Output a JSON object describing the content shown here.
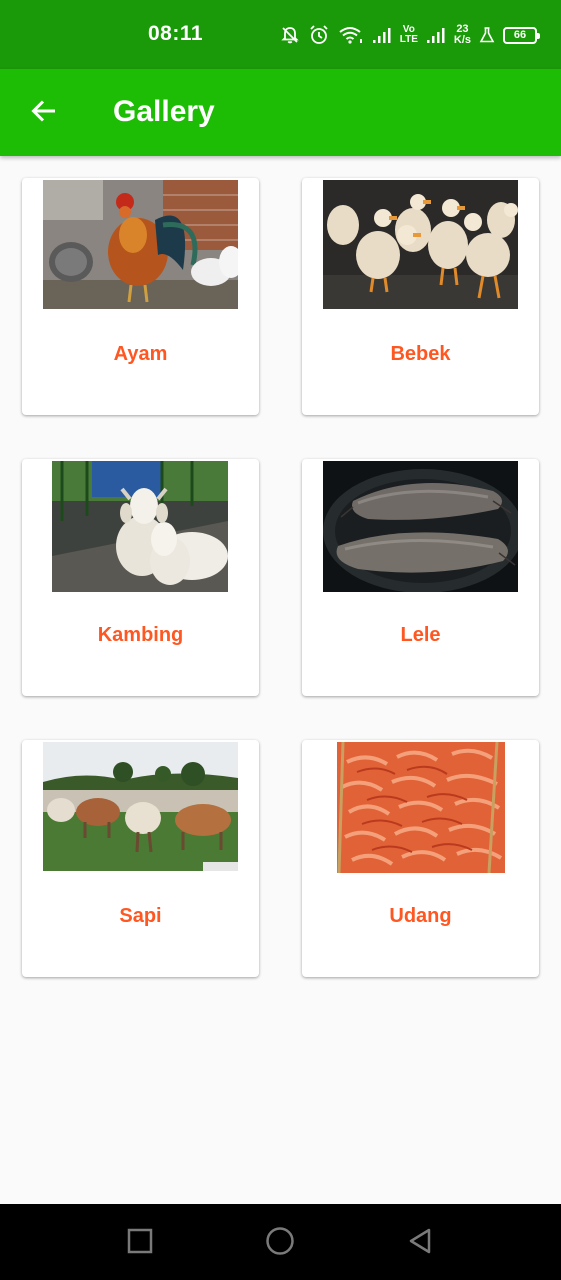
{
  "status_bar": {
    "time": "08:11",
    "network_label_top": "Vo",
    "network_label_bottom": "LTE",
    "speed_value": "23",
    "speed_unit": "K/s",
    "battery_level": "66"
  },
  "app_bar": {
    "title": "Gallery",
    "background_color": "#1ebd05"
  },
  "gallery": {
    "label_color": "#ff5722",
    "items": [
      {
        "label": "Ayam",
        "image": "chicken-photo"
      },
      {
        "label": "Bebek",
        "image": "duck-photo"
      },
      {
        "label": "Kambing",
        "image": "goat-photo"
      },
      {
        "label": "Lele",
        "image": "catfish-photo"
      },
      {
        "label": "Sapi",
        "image": "cattle-photo"
      },
      {
        "label": "Udang",
        "image": "shrimp-photo"
      }
    ]
  },
  "nav_bar": {
    "buttons": [
      "recent-apps-icon",
      "home-icon",
      "back-icon"
    ]
  }
}
